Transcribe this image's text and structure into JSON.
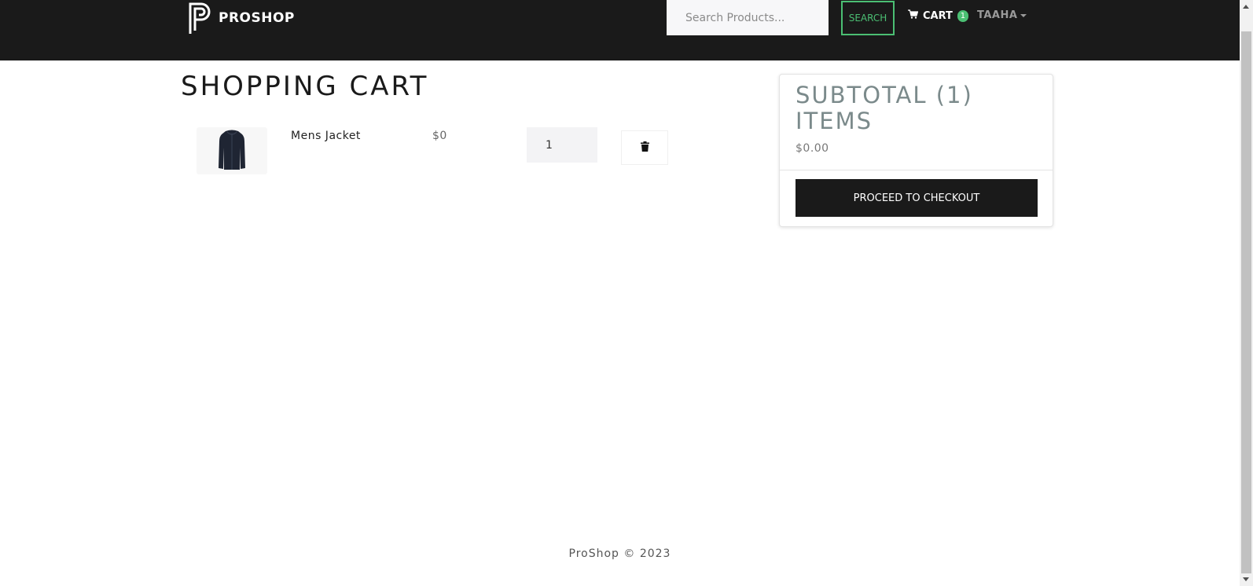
{
  "header": {
    "brand_name": "PROSHOP",
    "logo_icon": "proshop-logo-icon",
    "search": {
      "placeholder": "Search Products...",
      "value": ""
    },
    "search_button_label": "SEARCH",
    "cart": {
      "label": "CART",
      "count": "1",
      "icon": "cart-icon"
    },
    "user": {
      "name": "TAAHA"
    }
  },
  "main": {
    "page_title": "SHOPPING CART",
    "cart_items": [
      {
        "name": "Mens Jacket",
        "price": "$0",
        "qty": "1",
        "image_icon": "jacket-image",
        "delete_icon": "trash-icon"
      }
    ]
  },
  "summary": {
    "title": "SUBTOTAL (1) ITEMS",
    "total": "$0.00",
    "checkout_label": "PROCEED TO CHECKOUT"
  },
  "footer": {
    "text": "ProShop © 2023"
  },
  "colors": {
    "navbar": "#1a1a1a",
    "accent": "#4bbf73",
    "muted_title": "#7b8a8b"
  }
}
